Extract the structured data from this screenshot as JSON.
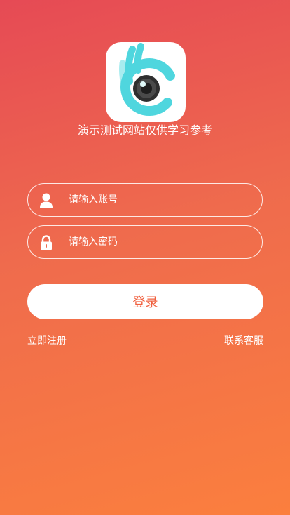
{
  "logo": {
    "icon": "camera-lens-logo-icon",
    "colors": {
      "teal": "#4fd6de",
      "lens": "#3a3a3a"
    }
  },
  "tagline": "演示测试网站仅供学习参考",
  "form": {
    "username": {
      "placeholder": "请输入账号",
      "value": "",
      "icon": "user-icon"
    },
    "password": {
      "placeholder": "请输入密码",
      "value": "",
      "icon": "lock-icon"
    },
    "login_label": "登录"
  },
  "links": {
    "register": "立即注册",
    "customer_service": "联系客服"
  },
  "colors": {
    "gradient_top": "#e64a55",
    "gradient_bottom": "#fb7f3e",
    "button_text": "#f0603f"
  }
}
